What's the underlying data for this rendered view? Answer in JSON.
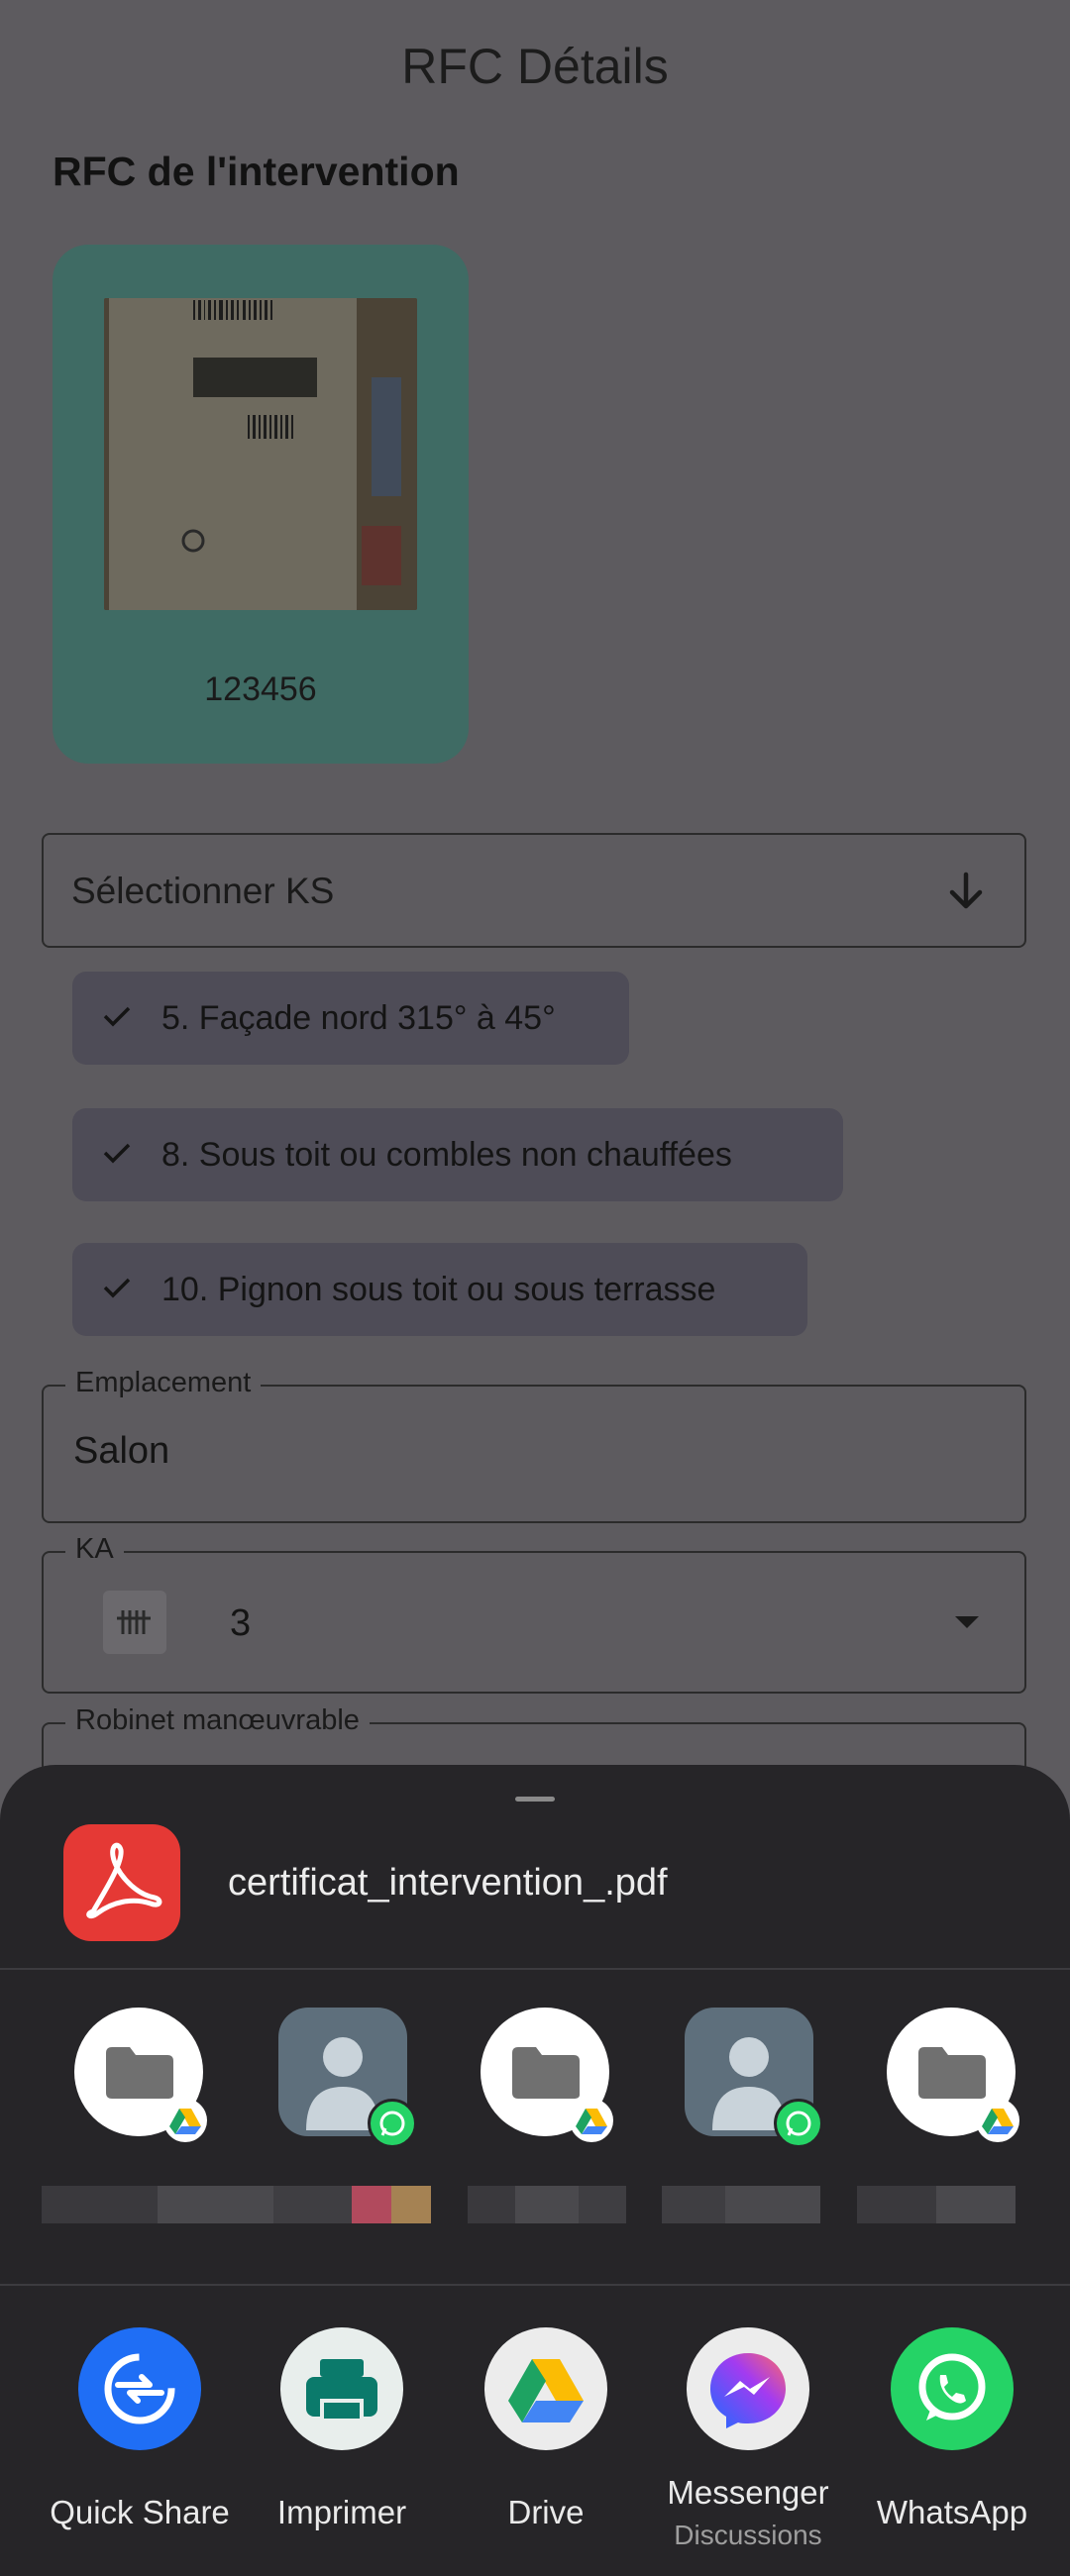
{
  "page": {
    "title": "RFC Détails",
    "section_title": "RFC de l'intervention"
  },
  "photo_card": {
    "label": "123456"
  },
  "ks_select": {
    "label": "Sélectionner KS"
  },
  "chips": [
    {
      "label": "5. Façade nord 315° à 45°"
    },
    {
      "label": "8. Sous toit ou combles non chauffées"
    },
    {
      "label": "10. Pignon sous toit ou sous terrasse"
    }
  ],
  "emplacement": {
    "legend": "Emplacement",
    "value": "Salon"
  },
  "ka": {
    "legend": "KA",
    "value": "3"
  },
  "robinet": {
    "legend": "Robinet manœuvrable"
  },
  "share_sheet": {
    "file_name": "certificat_intervention_.pdf",
    "direct_targets": [
      {
        "icon": "folder-icon",
        "badge": "drive-badge-icon"
      },
      {
        "icon": "person-icon",
        "badge": "whatsapp-badge-icon"
      },
      {
        "icon": "folder-icon",
        "badge": "drive-badge-icon"
      },
      {
        "icon": "person-icon",
        "badge": "whatsapp-badge-icon"
      },
      {
        "icon": "folder-icon",
        "badge": "drive-badge-icon"
      }
    ],
    "apps": [
      {
        "label": "Quick Share",
        "sub": ""
      },
      {
        "label": "Imprimer",
        "sub": ""
      },
      {
        "label": "Drive",
        "sub": ""
      },
      {
        "label": "Messenger",
        "sub": "Discussions"
      },
      {
        "label": "WhatsApp",
        "sub": ""
      }
    ]
  },
  "colors": {
    "accent_card": "#3f6b64",
    "chip": "#4e4c57",
    "sheet": "#262528",
    "pdf": "#e53935",
    "whatsapp": "#25d366"
  }
}
